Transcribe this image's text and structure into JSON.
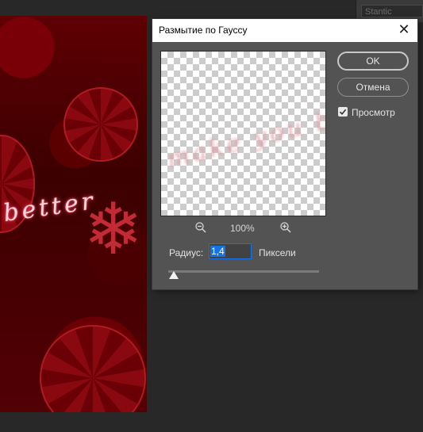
{
  "background_panel": {
    "field_text": "Stantic"
  },
  "canvas": {
    "script_text": "better"
  },
  "dialog": {
    "title": "Размытие по Гауссу",
    "preview_blur_text": "make you be",
    "zoom": {
      "level": "100%"
    },
    "radius": {
      "label": "Радиус:",
      "value": "1,4",
      "unit": "Пиксели"
    },
    "slider": {
      "fraction": 0.014
    },
    "buttons": {
      "ok": "OK",
      "cancel": "Отмена"
    },
    "preview_toggle": {
      "label": "Просмотр",
      "checked": true
    }
  },
  "icons": {
    "close": "close-icon",
    "zoom_out": "zoom-out-icon",
    "zoom_in": "zoom-in-icon",
    "checkbox": "checkmark-icon"
  },
  "colors": {
    "accent": "#1473e6",
    "dialog_bg": "#535353",
    "canvas_red": "#5e0003"
  }
}
